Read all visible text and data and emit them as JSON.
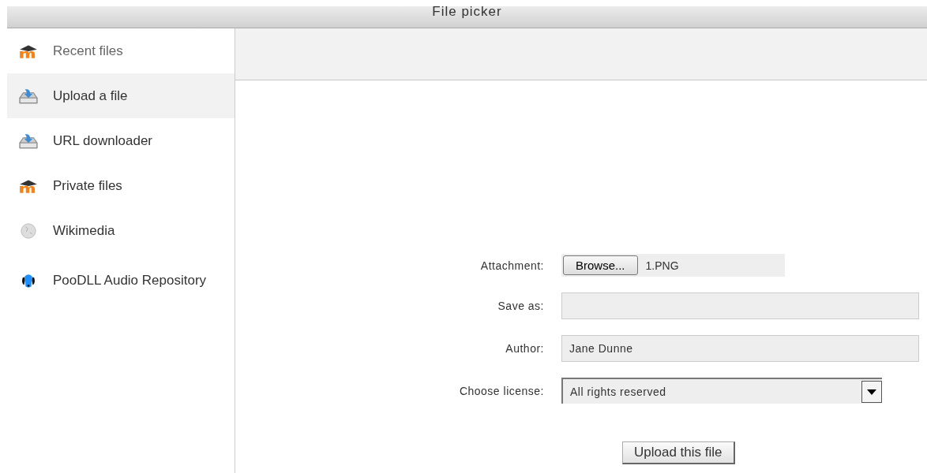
{
  "window": {
    "title": "File picker"
  },
  "sidebar": {
    "items": [
      {
        "label": "Recent files",
        "kind": "moodle",
        "selected": false
      },
      {
        "label": "Upload a file",
        "kind": "upload",
        "selected": true
      },
      {
        "label": "URL downloader",
        "kind": "upload",
        "selected": false
      },
      {
        "label": "Private files",
        "kind": "moodle",
        "selected": false
      },
      {
        "label": "Wikimedia",
        "kind": "globe",
        "selected": false
      },
      {
        "label": "PooDLL Audio Repository",
        "kind": "dog",
        "selected": false
      }
    ]
  },
  "form": {
    "attachment": {
      "label": "Attachment:",
      "button": "Browse...",
      "file": "1.PNG"
    },
    "save_as": {
      "label": "Save as:"
    },
    "author": {
      "label": "Author:",
      "value": "Jane Dunne"
    },
    "license": {
      "label": "Choose license:",
      "value": "All rights reserved"
    },
    "submit": "Upload this file"
  }
}
